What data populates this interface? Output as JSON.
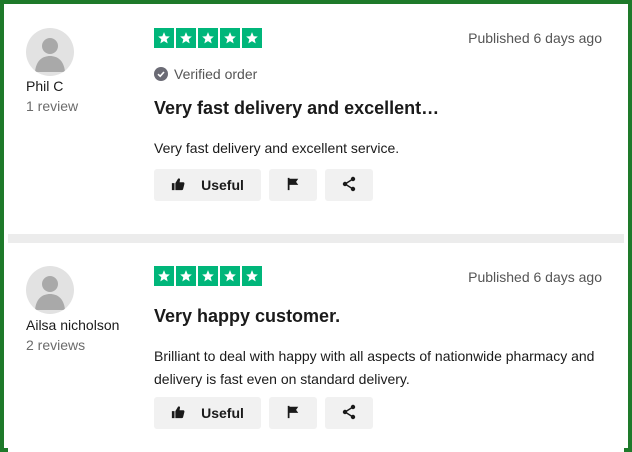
{
  "reviews": [
    {
      "user_name": "Phil C",
      "user_review_count": "1 review",
      "rating_stars": 5,
      "published": "Published 6 days ago",
      "verified": "Verified order",
      "title": "Very fast delivery and excellent…",
      "body": "Very fast delivery and excellent service.",
      "useful_label": "Useful"
    },
    {
      "user_name": "Ailsa nicholson",
      "user_review_count": "2 reviews",
      "rating_stars": 5,
      "published": "Published 6 days ago",
      "title": "Very happy customer.",
      "body": "Brilliant to deal with happy with all aspects of nationwide pharmacy and delivery is fast even on standard delivery.",
      "useful_label": "Useful"
    }
  ],
  "colors": {
    "star_green": "#00b67a",
    "frame_border": "#1e7a2a",
    "button_bg": "#f1f1f1"
  },
  "icons": [
    "avatar-placeholder-icon",
    "star-icon",
    "check-badge-icon",
    "thumbs-up-icon",
    "flag-icon",
    "share-icon"
  ]
}
